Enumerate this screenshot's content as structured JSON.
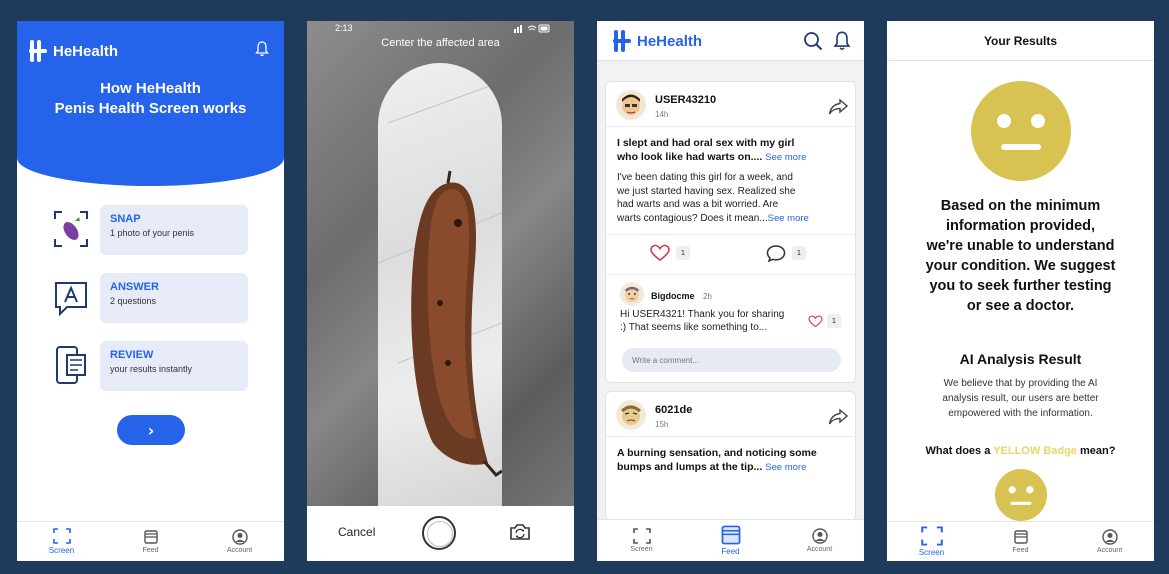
{
  "screen1": {
    "brand": "HeHealth",
    "hero_title_line1": "How HeHealth",
    "hero_title_line2": "Penis Health Screen works",
    "steps": [
      {
        "title": "SNAP",
        "subtitle": "1 photo of your penis",
        "icon": "eggplant-scan-icon"
      },
      {
        "title": "ANSWER",
        "subtitle": "2 questions",
        "icon": "question-chat-icon"
      },
      {
        "title": "REVIEW",
        "subtitle": "your results instantly",
        "icon": "phone-results-icon"
      }
    ],
    "next_button": "›",
    "tabs": [
      {
        "label": "Screen",
        "icon": "scan-icon",
        "active": true
      },
      {
        "label": "Feed",
        "icon": "feed-icon",
        "active": false
      },
      {
        "label": "Account",
        "icon": "account-icon",
        "active": false
      }
    ]
  },
  "screen2": {
    "status_time": "2:13",
    "hint": "Center the affected area",
    "cancel": "Cancel",
    "flip_icon": "flip-camera-icon"
  },
  "screen3": {
    "brand": "HeHealth",
    "posts": [
      {
        "user": "USER43210",
        "time": "14h",
        "title_line1": "I slept and had oral sex with my girl",
        "title_line2": "who look like had warts on....",
        "title_more": "See more",
        "body_line1": "I've been dating this girl for a week, and",
        "body_line2": "we just started having sex. Realized she",
        "body_line3": "had warts and was a bit worried. Are",
        "body_line4": "warts contagious? Does it mean...",
        "body_more": "See more",
        "likes": "1",
        "comments": "1",
        "comment": {
          "user": "Bigdocme",
          "time": "2h",
          "text_line1": "Hi USER4321! Thank you for sharing",
          "text_line2": ":) That seems like something to...",
          "likes": "1"
        },
        "comment_placeholder": "Write a comment..."
      },
      {
        "user": "6021de",
        "time": "15h",
        "title_line1": "A burning sensation, and noticing some",
        "title_line2": "bumps and lumps at the tip...",
        "title_more": "See more"
      }
    ],
    "tabs": [
      {
        "label": "Screen",
        "active": false
      },
      {
        "label": "Feed",
        "active": true
      },
      {
        "label": "Account",
        "active": false
      }
    ]
  },
  "screen4": {
    "header": "Your Results",
    "result_line1": "Based on the minimum",
    "result_line2": "information provided,",
    "result_line3": "we're unable to understand",
    "result_line4": "your condition. We suggest",
    "result_line5": "you to seek further testing",
    "result_line6": "or see a doctor.",
    "ai_title": "AI Analysis Result",
    "ai_desc_line1": "We believe that by providing the AI",
    "ai_desc_line2": "analysis result, our users are better",
    "ai_desc_line3": "empowered with the information.",
    "badge_q_pre": "What does a",
    "badge_q_word": "YELLOW Badge",
    "badge_q_post": "mean?",
    "tabs": [
      {
        "label": "Screen",
        "active": true
      },
      {
        "label": "Feed",
        "active": false
      },
      {
        "label": "Account",
        "active": false
      }
    ]
  },
  "colors": {
    "brand_blue": "#2563eb",
    "face_yellow": "#d8c251",
    "background": "#1f3b5c"
  }
}
